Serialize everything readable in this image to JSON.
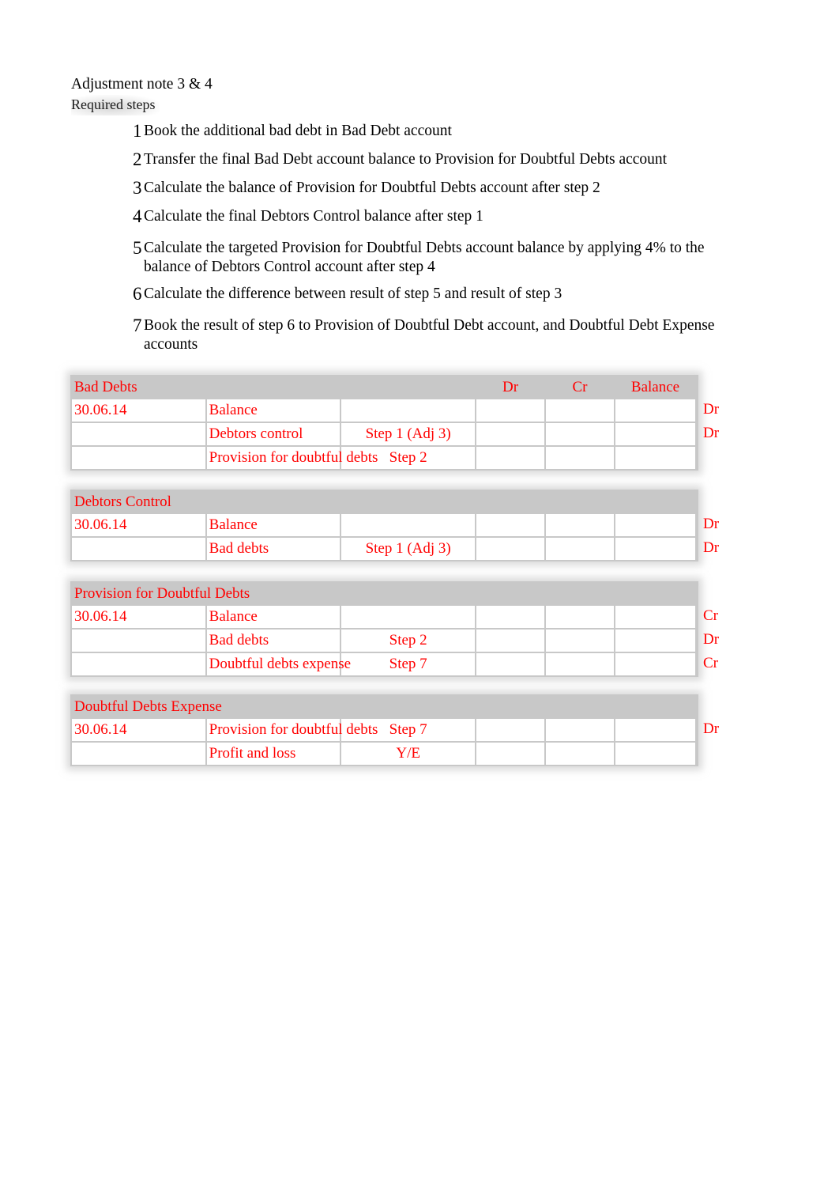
{
  "document": {
    "title": "Adjustment note 3 & 4",
    "subtitle": "Required steps"
  },
  "steps": [
    {
      "num": "1",
      "text": "Book the additional bad debt in Bad Debt account"
    },
    {
      "num": "2",
      "text": "Transfer the final Bad Debt account balance to Provision for Doubtful Debts account"
    },
    {
      "num": "3",
      "text": "Calculate the balance of Provision for Doubtful Debts account after step 2"
    },
    {
      "num": "4",
      "text": "Calculate the final Debtors Control balance after step 1"
    },
    {
      "num": "5",
      "text": "Calculate the targeted Provision for Doubtful Debts account balance by applying 4% to the balance of Debtors Control account after step 4"
    },
    {
      "num": "6",
      "text": "Calculate the difference between result of step 5 and result of step 3"
    },
    {
      "num": "7",
      "text": "Book the result of step 6 to Provision of Doubtful Debt account, and Doubtful Debt Expense accounts"
    }
  ],
  "ledger_headers": {
    "dr": "Dr",
    "cr": "Cr",
    "balance": "Balance"
  },
  "ledgers": [
    {
      "name": "Bad Debts",
      "rows": [
        {
          "date": "30.06.14",
          "description": "Balance",
          "step": "",
          "dr": "",
          "cr": "",
          "balance": "",
          "sign": "Dr"
        },
        {
          "date": "",
          "description": "Debtors control",
          "step": "Step 1 (Adj 3)",
          "dr": "",
          "cr": "",
          "balance": "",
          "sign": "Dr"
        },
        {
          "date": "",
          "description": "Provision for doubtful debts",
          "step": "Step 2",
          "dr": "",
          "cr": "",
          "balance": "",
          "sign": ""
        }
      ]
    },
    {
      "name": "Debtors Control",
      "rows": [
        {
          "date": "30.06.14",
          "description": "Balance",
          "step": "",
          "dr": "",
          "cr": "",
          "balance": "",
          "sign": "Dr"
        },
        {
          "date": "",
          "description": "Bad debts",
          "step": "Step 1 (Adj 3)",
          "dr": "",
          "cr": "",
          "balance": "",
          "sign": "Dr"
        }
      ]
    },
    {
      "name": "Provision for Doubtful Debts",
      "rows": [
        {
          "date": "30.06.14",
          "description": "Balance",
          "step": "",
          "dr": "",
          "cr": "",
          "balance": "",
          "sign": "Cr"
        },
        {
          "date": "",
          "description": "Bad debts",
          "step": "Step 2",
          "dr": "",
          "cr": "",
          "balance": "",
          "sign": "Dr"
        },
        {
          "date": "",
          "description": "Doubtful debts expense",
          "step": "Step 7",
          "dr": "",
          "cr": "",
          "balance": "",
          "sign": "Cr"
        }
      ]
    },
    {
      "name": "Doubtful Debts Expense",
      "rows": [
        {
          "date": "30.06.14",
          "description": "Provision for doubtful debts",
          "step": "Step 7",
          "dr": "",
          "cr": "",
          "balance": "",
          "sign": "Dr"
        },
        {
          "date": "",
          "description": "Profit and loss",
          "step": "Y/E",
          "dr": "",
          "cr": "",
          "balance": "",
          "sign": ""
        }
      ]
    }
  ],
  "colors": {
    "ledger_text": "#ff0000",
    "body_text": "#000000",
    "table_band": "#c8c8c8"
  }
}
